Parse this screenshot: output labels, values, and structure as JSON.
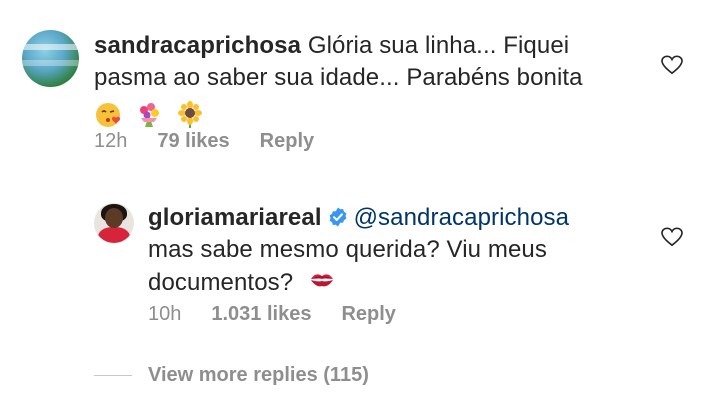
{
  "comments": [
    {
      "username": "sandracaprichosa",
      "text_line1": "Glória sua linha... Fiquei",
      "text_line2": "pasma ao saber sua idade... Parabéns bonita",
      "emojis": [
        "face-blowing-kiss",
        "bouquet",
        "sunflower"
      ],
      "time": "12h",
      "likes": "79 likes",
      "reply_label": "Reply"
    }
  ],
  "reply": {
    "username": "gloriamariareal",
    "verified": true,
    "mention": "@sandracaprichosa",
    "text_line1": "mas sabe mesmo querida? Viu meus",
    "text_line2": "documentos?",
    "emoji": "kiss-mark",
    "time": "10h",
    "likes": "1.031 likes",
    "reply_label": "Reply"
  },
  "view_more": {
    "label": "View more replies (115)"
  },
  "colors": {
    "text": "#262626",
    "meta": "#8e8e8e",
    "verified": "#3897f0",
    "mention": "#003569"
  }
}
